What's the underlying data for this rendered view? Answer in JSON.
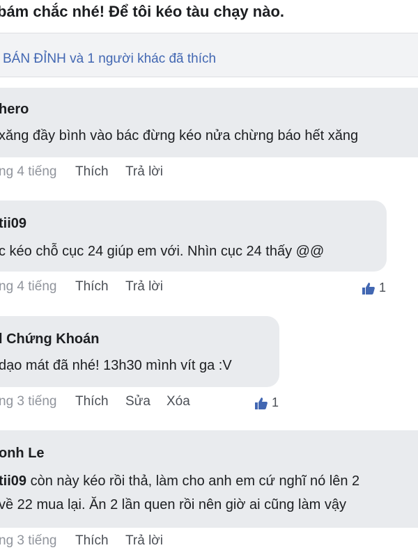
{
  "post": {
    "text": "bám chắc nhé! Để tôi kéo tàu chạy nào."
  },
  "likes_summary": "BÁN ĐỈNH và 1 người khác đã thích",
  "comments": [
    {
      "name": "hero",
      "lines": [
        "xăng đầy bình vào bác đừng kéo nửa chừng báo hết xăng"
      ],
      "time": "ng 4 tiếng",
      "actions": [
        "Thích",
        "Trả lời"
      ],
      "reaction_count": ""
    },
    {
      "name": "tii09",
      "lines": [
        "c kéo chỗ cục 24 giúp em với. Nhìn cục 24 thấy @@"
      ],
      "time": "ng 4 tiếng",
      "actions": [
        "Thích",
        "Trả lời"
      ],
      "reaction_count": "1"
    },
    {
      "name": "l Chứng Khoán",
      "lines": [
        "dạo mát đã nhé! 13h30 mình vít ga :V"
      ],
      "time": "ng 3 tiếng",
      "actions": [
        "Thích",
        "Sửa",
        "Xóa"
      ],
      "reaction_count": "1"
    },
    {
      "name": "onh Le",
      "tag": "tii09",
      "lines": [
        " còn này kéo rồi thả, làm cho anh em cứ nghĩ nó lên 2",
        "về 22 mua lại. Ăn 2 lần quen rồi nên giờ ai cũng làm vậy"
      ],
      "time": "ng 3 tiếng",
      "actions": [
        "Thích",
        "Trả lời"
      ],
      "reaction_count": ""
    }
  ],
  "colors": {
    "link_blue": "#4267b2",
    "bubble_gray": "#e9ebee",
    "like_icon_blue": "#4267b2",
    "muted_text": "#90949c"
  },
  "icons": {
    "like": "thumbs-up-icon"
  }
}
